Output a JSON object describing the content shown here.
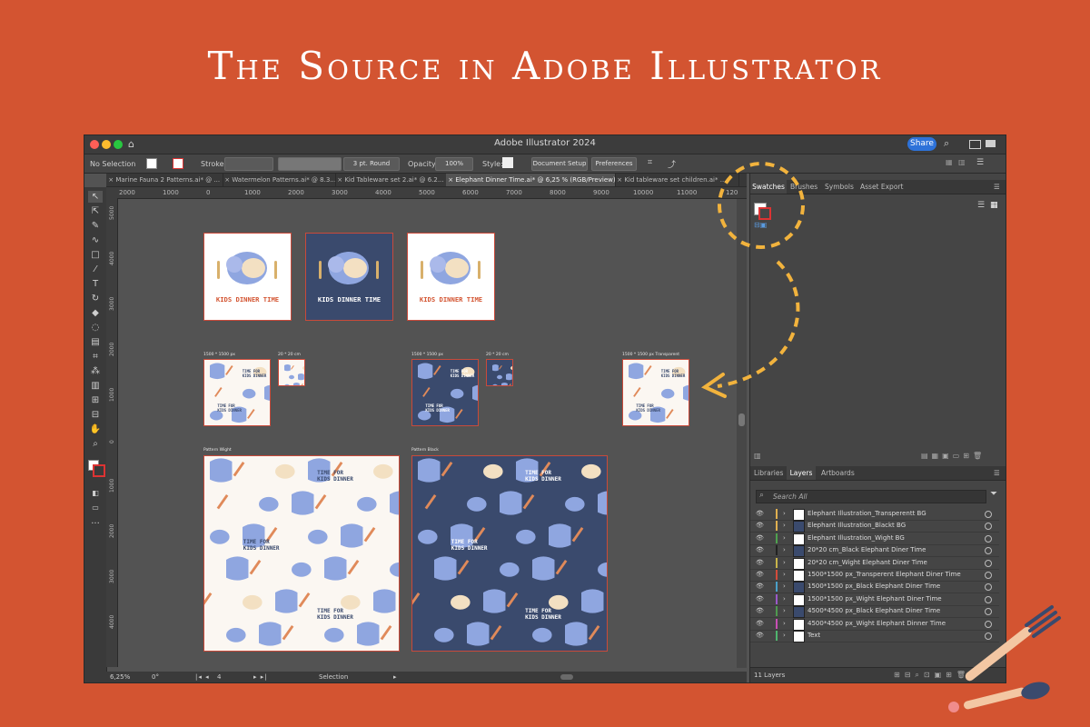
{
  "headline": "The Source in Adobe Illustrator",
  "app": {
    "title": "Adobe Illustrator 2024",
    "share_label": "Share",
    "colors": {
      "accent": "#d35431",
      "callout": "#f2b33d",
      "share": "#2d72d9"
    }
  },
  "control_bar": {
    "selection": "No Selection",
    "stroke_label": "Stroke:",
    "brush_value": "3 pt. Round",
    "opacity_label": "Opacity:",
    "opacity_value": "100%",
    "style_label": "Style:",
    "document_setup": "Document Setup",
    "preferences": "Preferences"
  },
  "tabs": [
    {
      "label": "Marine Fauna 2 Patterns.ai* @ ...",
      "active": false
    },
    {
      "label": "Watermelon Patterns.ai* @ 8.3...",
      "active": false
    },
    {
      "label": "Kid Tableware set 2.ai* @ 6.2...",
      "active": false
    },
    {
      "label": "Elephant Dinner Time.ai* @ 6,25 % (RGB/Preview)",
      "active": true
    },
    {
      "label": "Kid tableware set children.ai* ...",
      "active": false
    }
  ],
  "ruler": {
    "h_ticks": [
      "2000",
      "1000",
      "0",
      "1000",
      "2000",
      "3000",
      "4000",
      "5000",
      "6000",
      "7000",
      "8000",
      "9000",
      "10000",
      "11000",
      "120"
    ],
    "v_ticks": [
      "5000",
      "4000",
      "3000",
      "2000",
      "1000",
      "0",
      "1000",
      "2000",
      "3000",
      "4000"
    ]
  },
  "artboards": {
    "kids_text": "KIDS DINNER TIME",
    "pattern_text_1": "TIME FOR",
    "pattern_text_2": "KIDS DINNER",
    "labels": {
      "a1": "1500 * 1500 px",
      "a2": "20 * 20 cm",
      "a3": "1500 * 1500 px",
      "a4": "20 * 20 cm",
      "a5": "1500 * 1500 px Transparent",
      "a6": "Pattern Wight",
      "a7": "Pattern Black"
    }
  },
  "status": {
    "zoom": "6,25%",
    "angle": "0°",
    "artboard_num": "4",
    "tool": "Selection"
  },
  "panel": {
    "top_tabs": [
      "Swatches",
      "Brushes",
      "Symbols",
      "Asset Export"
    ],
    "bottom_tabs": [
      "Libraries",
      "Layers",
      "Artboards"
    ],
    "search_placeholder": "Search All",
    "layer_count": "11 Layers",
    "layers": [
      {
        "name": "Elephant Illustration_Transperentt BG",
        "color": "#e0b050",
        "thumb": "#ffffff"
      },
      {
        "name": "Elephant Illustration_Blackt BG",
        "color": "#e0b050",
        "thumb": "#3a4a6d"
      },
      {
        "name": "Elephant Illustration_Wight BG",
        "color": "#4fa14f",
        "thumb": "#ffffff"
      },
      {
        "name": "20*20 cm_Black Elephant Diner Time",
        "color": "#222222",
        "thumb": "#3a4a6d"
      },
      {
        "name": "20*20 cm_Wight Elephant Diner Time",
        "color": "#c9b54a",
        "thumb": "#ffffff"
      },
      {
        "name": "1500*1500 px_Transperent Elephant Diner Time",
        "color": "#d34b3b",
        "thumb": "#ffffff"
      },
      {
        "name": "1500*1500 px_Black Elephant Diner Time",
        "color": "#4aa0c9",
        "thumb": "#3a4a6d"
      },
      {
        "name": "1500*1500 px_Wight Elephant Diner Time",
        "color": "#9b59c9",
        "thumb": "#ffffff"
      },
      {
        "name": "4500*4500 px_Black Elephant Diner Time",
        "color": "#4f9a4f",
        "thumb": "#3a4a6d"
      },
      {
        "name": "4500*4500 px_Wight Elephant Dinner Time",
        "color": "#c94fb5",
        "thumb": "#ffffff"
      },
      {
        "name": "Text",
        "color": "#4fb56e",
        "thumb": "#ffffff"
      }
    ]
  }
}
